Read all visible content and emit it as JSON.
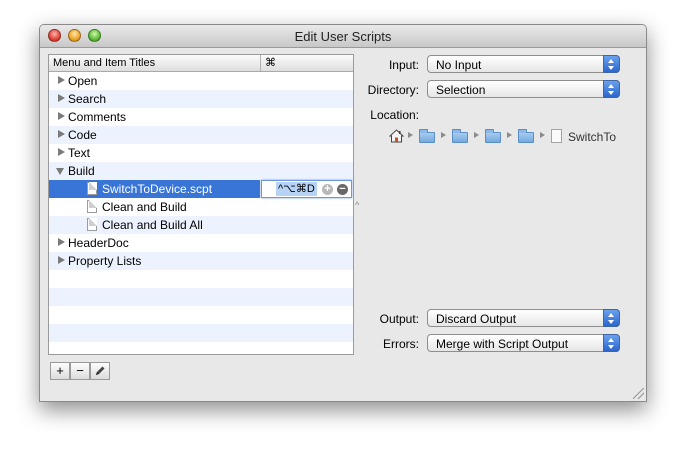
{
  "window": {
    "title": "Edit User Scripts"
  },
  "outline": {
    "columns": {
      "title": "Menu and Item Titles",
      "shortcut": "⌘"
    },
    "rows": [
      {
        "label": "Open",
        "disclosure": "closed",
        "kind": "group"
      },
      {
        "label": "Search",
        "disclosure": "closed",
        "kind": "group"
      },
      {
        "label": "Comments",
        "disclosure": "closed",
        "kind": "group"
      },
      {
        "label": "Code",
        "disclosure": "closed",
        "kind": "group"
      },
      {
        "label": "Text",
        "disclosure": "closed",
        "kind": "group"
      },
      {
        "label": "Build",
        "disclosure": "open",
        "kind": "group"
      },
      {
        "label": "SwitchToDevice.scpt",
        "kind": "script",
        "selected": true,
        "shortcut": "^⌥⌘D"
      },
      {
        "label": "Clean and Build",
        "kind": "script"
      },
      {
        "label": "Clean and Build All",
        "kind": "script"
      },
      {
        "label": "HeaderDoc",
        "disclosure": "closed",
        "kind": "group"
      },
      {
        "label": "Property Lists",
        "disclosure": "closed",
        "kind": "group"
      }
    ],
    "shortcut_add": "+",
    "shortcut_remove": "−"
  },
  "bottom_buttons": {
    "add": "+",
    "remove": "−",
    "edit_icon": "pencil-icon"
  },
  "fields": {
    "input": {
      "label": "Input:",
      "value": "No Input"
    },
    "directory": {
      "label": "Directory:",
      "value": "Selection"
    },
    "location": {
      "label": "Location:",
      "file_name": "SwitchTo"
    },
    "output": {
      "label": "Output:",
      "value": "Discard Output"
    },
    "errors": {
      "label": "Errors:",
      "value": "Merge with Script Output"
    }
  },
  "colors": {
    "selection": "#3875d7",
    "alternate_row": "#edf3fe",
    "popup_arrow": "#2a66cc"
  }
}
